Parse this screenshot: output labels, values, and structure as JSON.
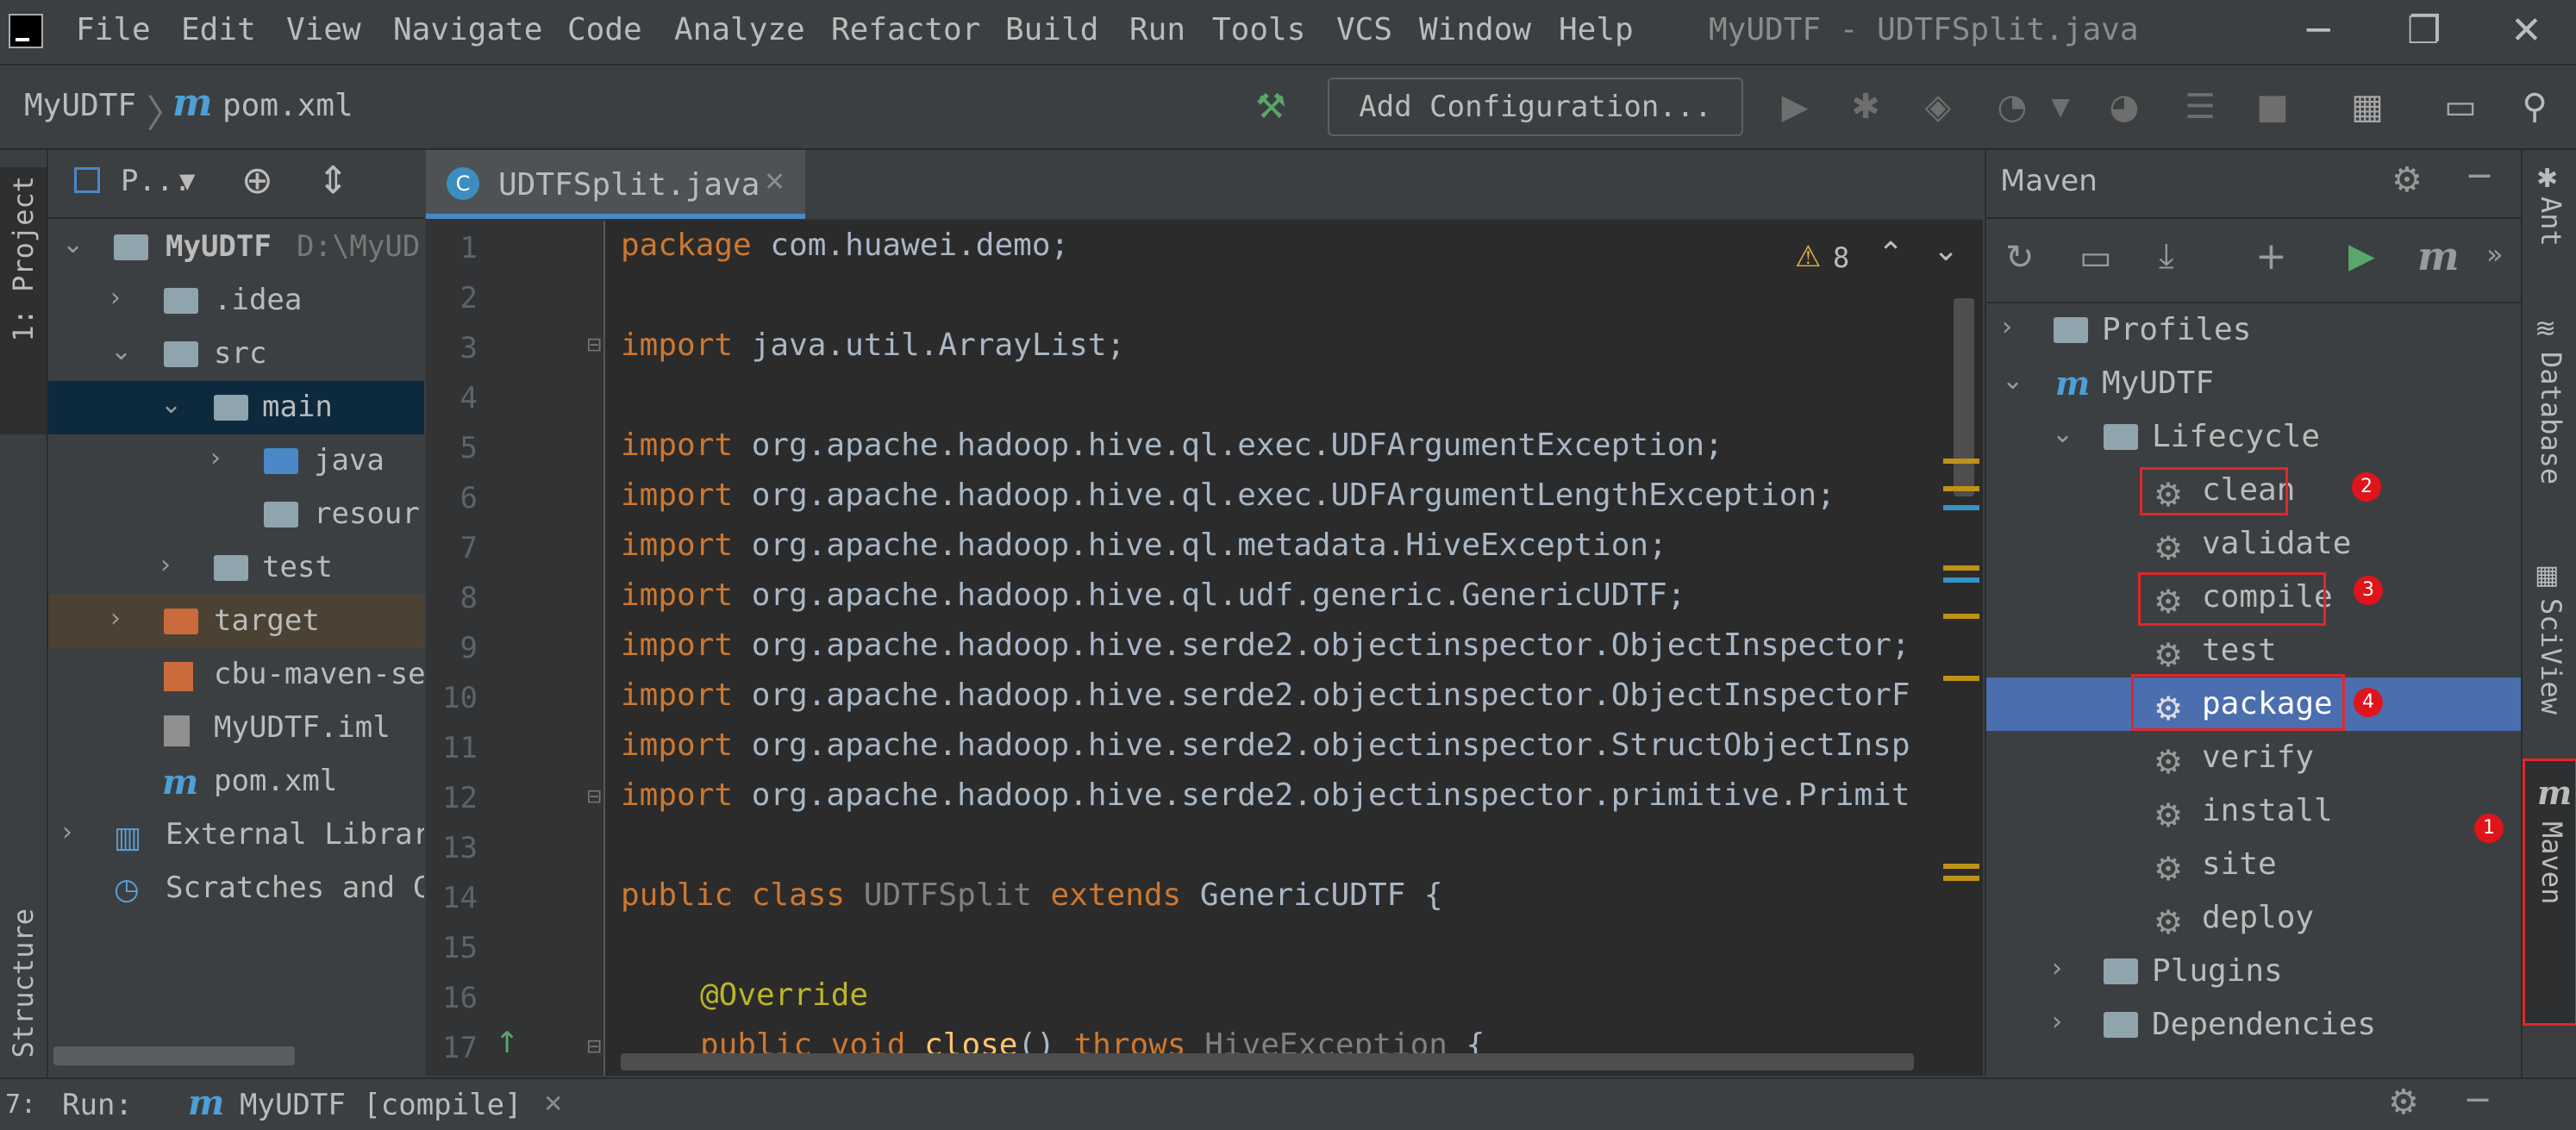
{
  "window": {
    "title": "MyUDTF - UDTFSplit.java",
    "menu": [
      "File",
      "Edit",
      "View",
      "Navigate",
      "Code",
      "Analyze",
      "Refactor",
      "Build",
      "Run",
      "Tools",
      "VCS",
      "Window",
      "Help"
    ],
    "controls": {
      "minimize": "─",
      "restore": "❐",
      "close": "✕"
    }
  },
  "navbar": {
    "project": "MyUDTF",
    "file": "pom.xml",
    "add_configuration": "Add Configuration..."
  },
  "project_panel": {
    "view_label": "P...",
    "vertical_tab": "1: Project",
    "tree": [
      {
        "label": "MyUDTF",
        "hint": "D:\\MyUD"
      },
      {
        "label": ".idea"
      },
      {
        "label": "src"
      },
      {
        "label": "main"
      },
      {
        "label": "java"
      },
      {
        "label": "resour"
      },
      {
        "label": "test"
      },
      {
        "label": "target"
      },
      {
        "label": "cbu-maven-se"
      },
      {
        "label": "MyUDTF.iml"
      },
      {
        "label": "pom.xml"
      },
      {
        "label": "External Librar"
      },
      {
        "label": "Scratches and C"
      }
    ],
    "structure_tab": "Structure"
  },
  "editor": {
    "tab": "UDTFSplit.java",
    "tab_icon": "C",
    "warning_count": "8",
    "lines": [
      "1",
      "2",
      "3",
      "4",
      "5",
      "6",
      "7",
      "8",
      "9",
      "10",
      "11",
      "12",
      "13",
      "14",
      "15",
      "16",
      "17"
    ],
    "code": {
      "l1_kw": "package ",
      "l1_rest": "com.huawei.demo;",
      "l3_kw": "import ",
      "l3_rest": "java.util.ArrayList;",
      "l5": "org.apache.hadoop.hive.ql.exec.UDFArgumentException;",
      "l6": "org.apache.hadoop.hive.ql.exec.UDFArgumentLengthException;",
      "l7": "org.apache.hadoop.hive.ql.metadata.HiveException;",
      "l8": "org.apache.hadoop.hive.ql.udf.generic.GenericUDTF;",
      "l9": "org.apache.hadoop.hive.serde2.objectinspector.ObjectInspector;",
      "l10": "org.apache.hadoop.hive.serde2.objectinspector.ObjectInspectorF",
      "l11": "org.apache.hadoop.hive.serde2.objectinspector.StructObjectInsp",
      "l12": "org.apache.hadoop.hive.serde2.objectinspector.primitive.Primit",
      "import_kw": "import ",
      "l14_kw1": "public class ",
      "l14_name": "UDTFSplit ",
      "l14_kw2": "extends ",
      "l14_rest": "GenericUDTF {",
      "l16": "@Override",
      "l17_kw": "public void ",
      "l17_fn": "close",
      "l17_mid": "() ",
      "l17_kw2": "throws ",
      "l17_exc": "HiveException ",
      "l17_end": "{"
    }
  },
  "maven": {
    "title": "Maven",
    "tree": {
      "profiles": "Profiles",
      "project": "MyUDTF",
      "lifecycle": "Lifecycle",
      "phases": [
        "clean",
        "validate",
        "compile",
        "test",
        "package",
        "verify",
        "install",
        "site",
        "deploy"
      ],
      "plugins": "Plugins",
      "dependencies": "Dependencies"
    },
    "selected": "package",
    "badges": [
      "1",
      "2",
      "3",
      "4"
    ]
  },
  "right_tabs": [
    "Ant",
    "Database",
    "SciView",
    "Maven"
  ],
  "runbar": {
    "label": "Run:",
    "config": "MyUDTF [compile]",
    "vertical": "7:"
  },
  "colors": {
    "accent": "#4a88c7",
    "selection": "#4b6eaf",
    "badge": "#e0141b",
    "build_hammer": "#59a869",
    "run_green": "#59a869"
  }
}
